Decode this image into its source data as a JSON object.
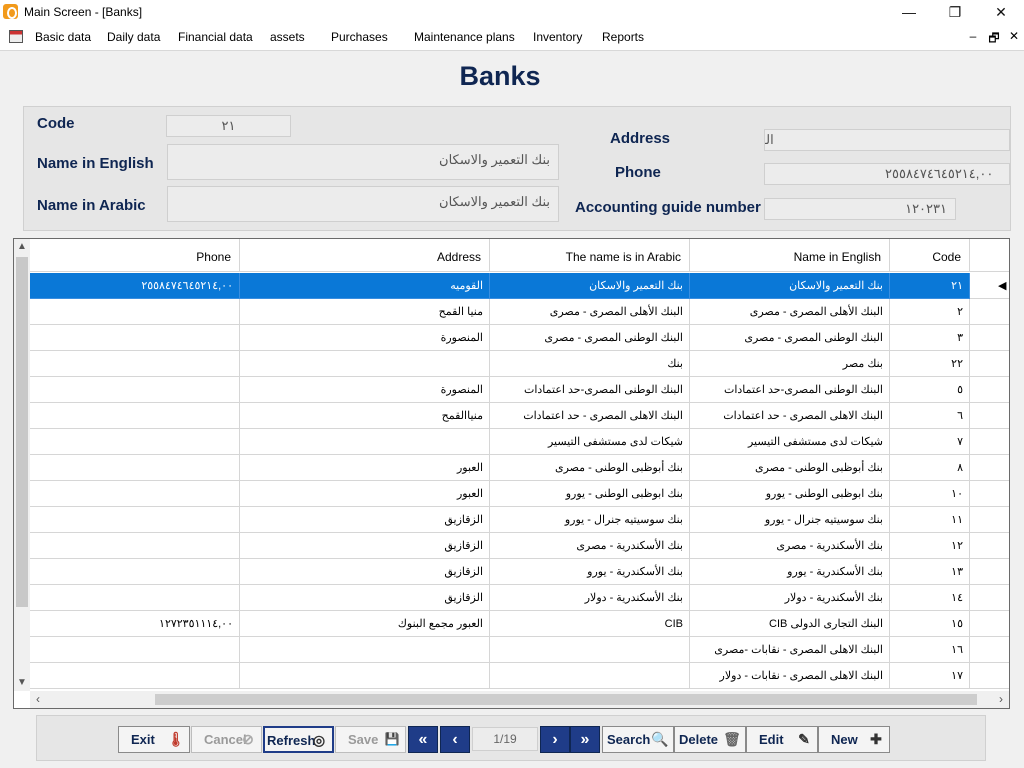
{
  "window": {
    "title": "Main Screen - [Banks]",
    "minimize_glyph": "—",
    "maximize_glyph": "❐",
    "close_glyph": "✕"
  },
  "menu": {
    "items": [
      "Basic data",
      "Daily data",
      "Financial data",
      "assets",
      "Purchases",
      "Maintenance plans",
      "Inventory",
      "Reports"
    ],
    "mdi_minimize": "‒",
    "mdi_restore": "🗗",
    "mdi_close": "✕"
  },
  "form": {
    "title": "Banks",
    "labels": {
      "code": "Code",
      "name_en": "Name in English",
      "name_ar": "Name in Arabic",
      "address": "Address",
      "phone": "Phone",
      "guide": "Accounting guide number"
    },
    "values": {
      "code": "٢١",
      "name_en": "بنك التعمير والاسكان",
      "name_ar": "بنك التعمير والاسكان",
      "address": "القوميه",
      "phone": "٢٥٥٨٤٧٤٦٤٥٢١٤,٠٠",
      "guide": "١٢٠٢٣١"
    }
  },
  "grid": {
    "headers": {
      "phone": "Phone",
      "address": "Address",
      "name_ar": "The name is in Arabic",
      "name_en": "Name in English",
      "code": "Code"
    },
    "selected_row": 0,
    "rows": [
      {
        "code": "٢١",
        "name_en": "بنك التعمير والاسكان",
        "name_ar": "بنك التعمير والاسكان",
        "address": "القوميه",
        "phone": "٢٥٥٨٤٧٤٦٤٥٢١٤,٠٠"
      },
      {
        "code": "٢",
        "name_en": "البنك الأهلى المصرى - مصرى",
        "name_ar": "البنك الأهلى المصرى - مصرى",
        "address": "منيا القمح",
        "phone": ""
      },
      {
        "code": "٣",
        "name_en": "البنك الوطنى المصرى - مصرى",
        "name_ar": "البنك الوطنى المصرى - مصرى",
        "address": "المنصورة",
        "phone": ""
      },
      {
        "code": "٢٢",
        "name_en": "بنك مصر",
        "name_ar": "بنك",
        "address": "",
        "phone": ""
      },
      {
        "code": "٥",
        "name_en": "البنك الوطنى المصرى-حد اعتمادات",
        "name_ar": "البنك الوطنى المصرى-حد اعتمادات",
        "address": "المنصورة",
        "phone": ""
      },
      {
        "code": "٦",
        "name_en": "البنك الاهلى المصرى - حد اعتمادات",
        "name_ar": "البنك الاهلى المصرى - حد اعتمادات",
        "address": "منياالقمح",
        "phone": ""
      },
      {
        "code": "٧",
        "name_en": "شيكات لدى مستشفى التيسير",
        "name_ar": "شيكات لدى مستشفى التيسير",
        "address": "",
        "phone": ""
      },
      {
        "code": "٨",
        "name_en": "بنك أبوظبى الوطنى - مصرى",
        "name_ar": "بنك أبوظبى الوطنى - مصرى",
        "address": "العبور",
        "phone": ""
      },
      {
        "code": "١٠",
        "name_en": "بنك ابوظبى الوطنى - يورو",
        "name_ar": "بنك ابوظبى الوطنى - يورو",
        "address": "العبور",
        "phone": ""
      },
      {
        "code": "١١",
        "name_en": "بنك سوسيتيه جنرال - يورو",
        "name_ar": "بنك سوسيتيه جنرال - يورو",
        "address": "الزقازيق",
        "phone": ""
      },
      {
        "code": "١٢",
        "name_en": "بنك الأسكندرية - مصرى",
        "name_ar": "بنك الأسكندرية - مصرى",
        "address": "الزقازيق",
        "phone": ""
      },
      {
        "code": "١٣",
        "name_en": "بنك الأسكندرية - يورو",
        "name_ar": "بنك الأسكندرية - يورو",
        "address": "الزقازيق",
        "phone": ""
      },
      {
        "code": "١٤",
        "name_en": "بنك الأسكندرية - دولار",
        "name_ar": "بنك الأسكندرية - دولار",
        "address": "الزقازيق",
        "phone": ""
      },
      {
        "code": "١٥",
        "name_en": "CIB  البنك التجارى الدولى",
        "name_ar": "CIB",
        "address": "العبور مجمع البنوك",
        "phone": "١٢٧٢٣٥١١١٤,٠٠"
      },
      {
        "code": "١٦",
        "name_en": "البنك الاهلى المصرى - نقابات -مصرى",
        "name_ar": "",
        "address": "",
        "phone": ""
      },
      {
        "code": "١٧",
        "name_en": "البنك الاهلى المصرى - نقابات - دولار",
        "name_ar": "",
        "address": "",
        "phone": ""
      }
    ]
  },
  "footer": {
    "buttons": [
      {
        "key": "exit",
        "label": "Exit",
        "icon": "🌡",
        "state": "active"
      },
      {
        "key": "cancel",
        "label": "Cancel",
        "icon": "⊘",
        "state": "disabled"
      },
      {
        "key": "refresh",
        "label": "Refresh",
        "icon": "◎",
        "state": "active"
      },
      {
        "key": "save",
        "label": "Save",
        "icon": "💾",
        "state": "disabled"
      },
      {
        "key": "search",
        "label": "Search",
        "icon": "🔍",
        "state": "active"
      },
      {
        "key": "delete",
        "label": "Delete",
        "icon": "🗑",
        "state": "active"
      },
      {
        "key": "edit",
        "label": "Edit",
        "icon": "✎",
        "state": "active"
      },
      {
        "key": "new",
        "label": "New",
        "icon": "✚",
        "state": "active"
      }
    ],
    "page_indicator": "1/19",
    "nav": {
      "first": "«",
      "prev": "‹",
      "next": "›",
      "last": "»"
    }
  }
}
